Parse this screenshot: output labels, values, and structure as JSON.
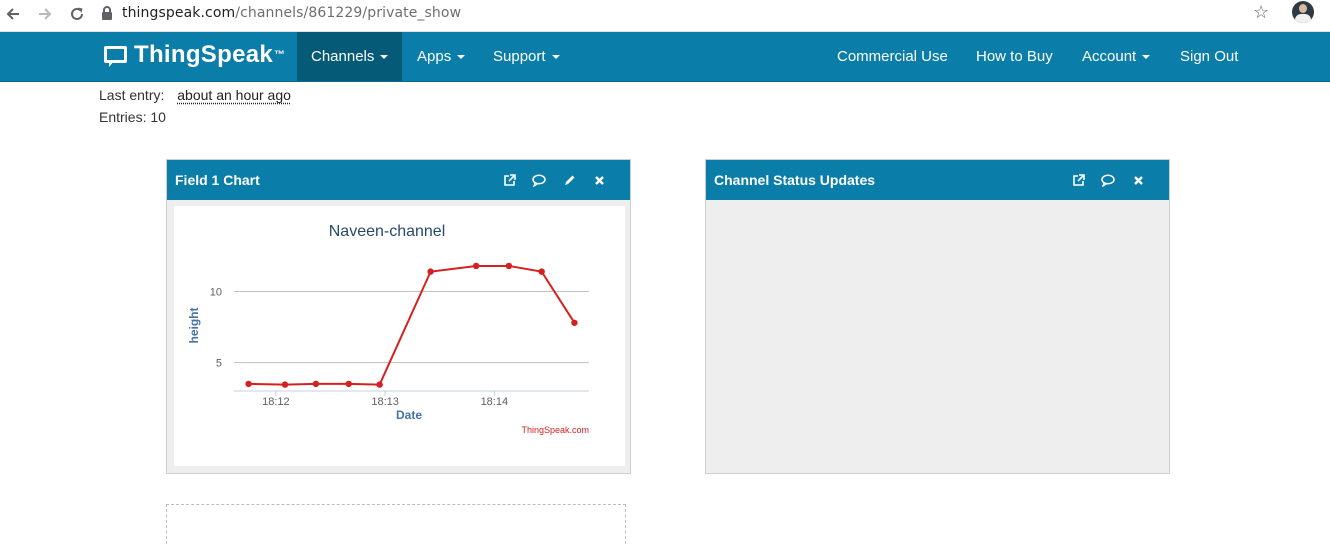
{
  "browser": {
    "url_domain": "thingspeak.com",
    "url_path": "/channels/861229/private_show",
    "back_icon": "arrow-left-icon",
    "forward_icon": "arrow-right-icon",
    "reload_icon": "reload-icon",
    "star_icon": "star-icon"
  },
  "navbar": {
    "brand": "ThingSpeak",
    "brand_tm": "™",
    "left_items": [
      "Channels",
      "Apps",
      "Support"
    ],
    "right_items": [
      "Commercial Use",
      "How to Buy",
      "Account",
      "Sign Out"
    ],
    "active_item": "Channels",
    "color": "#0a7ea8"
  },
  "info": {
    "last_entry_label": "Last entry:",
    "last_entry_value": "about an hour ago",
    "entries_label": "Entries: 10"
  },
  "field_panel": {
    "title": "Field 1 Chart",
    "icons": [
      "external-link-icon",
      "comment-icon",
      "pencil-icon",
      "close-icon"
    ]
  },
  "status_panel": {
    "title": "Channel Status Updates",
    "icons": [
      "external-link-icon",
      "comment-icon",
      "close-icon"
    ]
  },
  "chart_data": {
    "type": "line",
    "title": "Naveen-channel",
    "xlabel": "Date",
    "ylabel": "height",
    "credit": "ThingSpeak.com",
    "x_ticks": [
      "18:12",
      "18:13",
      "18:14"
    ],
    "y_ticks": [
      5,
      10
    ],
    "ylim": [
      3,
      12.5
    ],
    "series": [
      {
        "color": "#d62020",
        "x": [
          "18:11:45",
          "18:12:05",
          "18:12:22",
          "18:12:40",
          "18:12:57",
          "18:13:25",
          "18:13:50",
          "18:14:08",
          "18:14:26",
          "18:14:44"
        ],
        "y": [
          3.5,
          3.45,
          3.5,
          3.5,
          3.45,
          11.4,
          11.8,
          11.8,
          11.4,
          7.8
        ]
      }
    ]
  }
}
